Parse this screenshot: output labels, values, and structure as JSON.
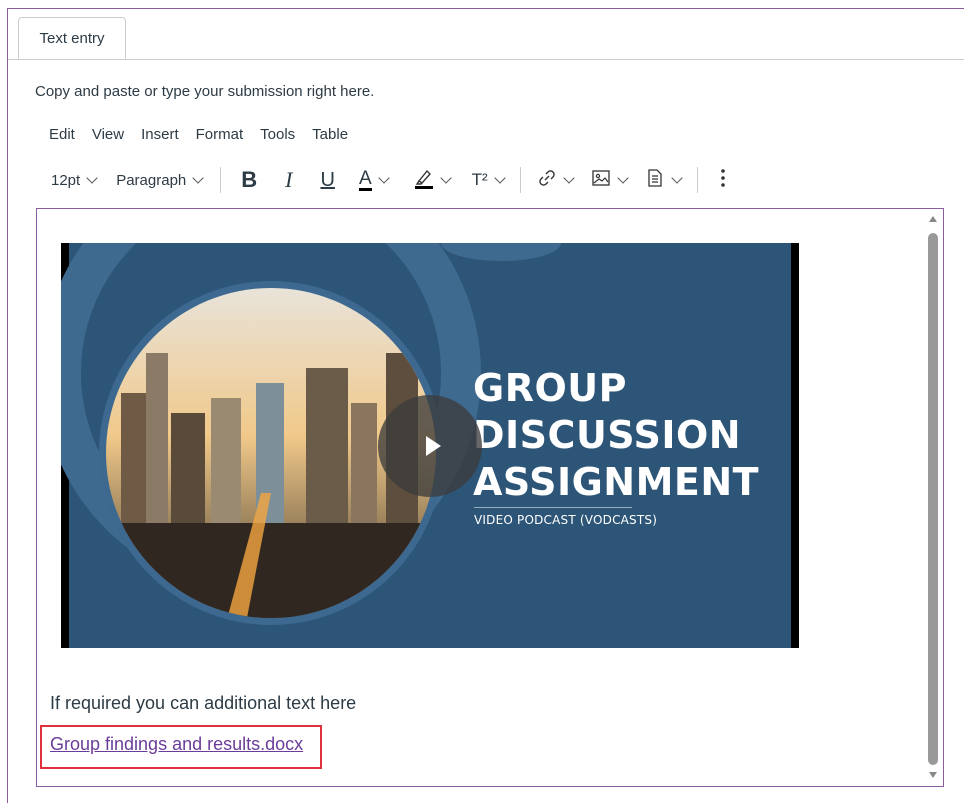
{
  "tabs": [
    {
      "label": "Text entry"
    }
  ],
  "instruction": "Copy and paste or type your submission right here.",
  "menubar": [
    "Edit",
    "View",
    "Insert",
    "Format",
    "Tools",
    "Table"
  ],
  "toolbar": {
    "font_size": "12pt",
    "block_format": "Paragraph",
    "bold_label": "B",
    "italic_label": "I",
    "underline_label": "U",
    "text_color_label": "A",
    "superscript_label": "T²"
  },
  "video": {
    "title_lines": [
      "GROUP",
      "DISCUSSION",
      "ASSIGNMENT"
    ],
    "subtitle": "VIDEO PODCAST (VODCASTS)"
  },
  "content": {
    "text": "If required you can additional text here",
    "link": "Group findings and results.docx"
  },
  "colors": {
    "focus_border": "#8a5d9e",
    "link": "#6b3d99",
    "highlight": "#e0303b",
    "slide_bg": "#2c5578"
  }
}
